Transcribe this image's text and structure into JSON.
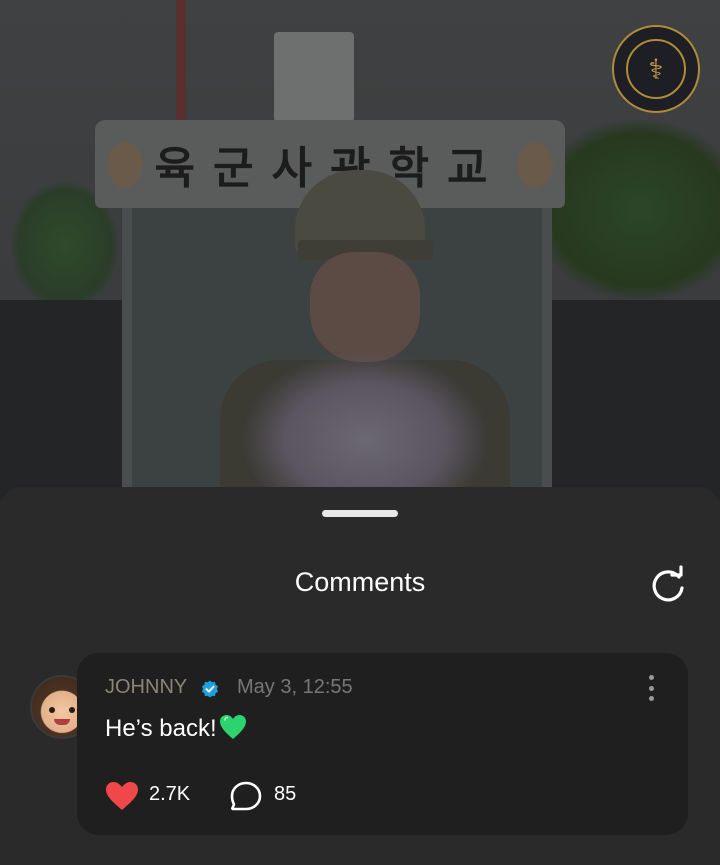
{
  "photo": {
    "sign_text": "육군사관학교"
  },
  "sheet": {
    "title": "Comments"
  },
  "comment": {
    "author": "JOHNNY",
    "timestamp": "May 3, 12:55",
    "text": "He’s back!",
    "likes": "2.7K",
    "replies": "85"
  },
  "colors": {
    "like": "#f0474b",
    "verified": "#1ca0e0",
    "emoji_heart": "#2bd46e"
  },
  "icons": [
    "refresh-icon",
    "verified-badge-icon",
    "more-options-icon",
    "heart-icon",
    "comment-bubble-icon",
    "green-heart-emoji"
  ]
}
